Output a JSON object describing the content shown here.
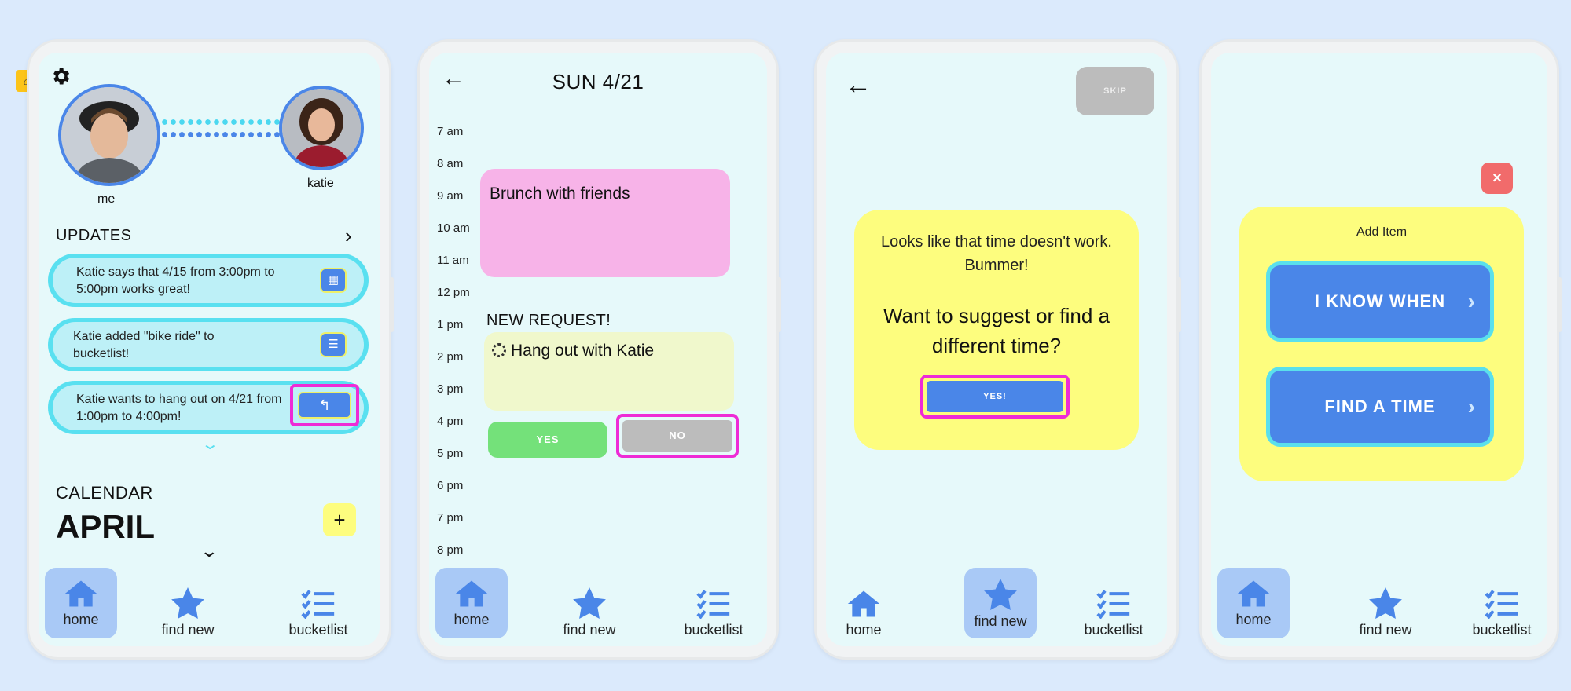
{
  "colors": {
    "page_bg": "#dbeafc",
    "screen_bg": "#e6f9fa",
    "accent_blue": "#4a86e8",
    "highlight_magenta": "#ee2bd6",
    "card_yellow": "#fdfd7e",
    "event_pink": "#f7b3e8",
    "yes_green": "#74e17a"
  },
  "nav": {
    "home": "home",
    "find_new": "find new",
    "bucketlist": "bucketlist"
  },
  "screen1": {
    "me_label": "me",
    "friend_label": "katie",
    "updates_title": "UPDATES",
    "updates": [
      {
        "text": "Katie says that 4/15 from 3:00pm to 5:00pm works great!",
        "icon": "calendar-icon"
      },
      {
        "text": "Katie added \"bike ride\" to bucketlist!",
        "icon": "list-icon"
      },
      {
        "text": "Katie wants to hang out on 4/21 from 1:00pm to 4:00pm!",
        "icon": "reply-icon"
      }
    ],
    "calendar_title": "CALENDAR",
    "month": "APRIL",
    "add_label": "+"
  },
  "screen2": {
    "date": "SUN 4/21",
    "hours": [
      "7 am",
      "8 am",
      "9 am",
      "10 am",
      "11 am",
      "12 pm",
      "1 pm",
      "2 pm",
      "3 pm",
      "4 pm",
      "5 pm",
      "6 pm",
      "7 pm",
      "8 pm"
    ],
    "event": "Brunch with friends",
    "new_request_title": "NEW REQUEST!",
    "request_event": "Hang out with Katie",
    "yes_label": "YES",
    "no_label": "NO"
  },
  "screen3": {
    "skip_label": "SKIP",
    "message_small": "Looks like that time doesn't work. Bummer!",
    "message_big": "Want to suggest or find a different time?",
    "yes_label": "YES!"
  },
  "screen4": {
    "close_label": "×",
    "title": "Add Item",
    "btn_know": "I KNOW WHEN",
    "btn_find": "FIND A TIME"
  }
}
